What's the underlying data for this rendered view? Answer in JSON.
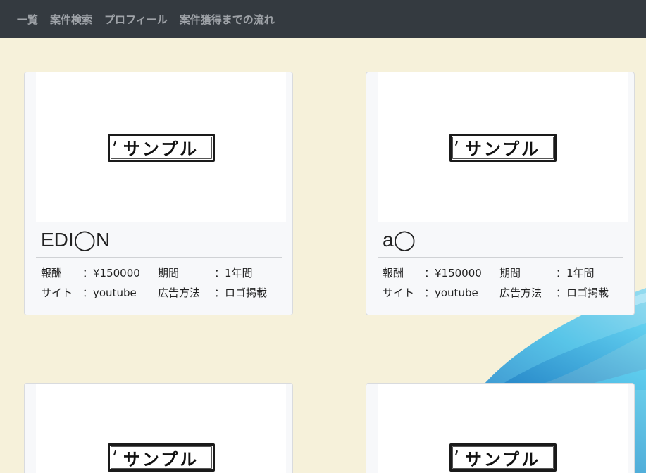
{
  "nav": {
    "items": [
      "一覧",
      "案件検索",
      "プロフィール",
      "案件獲得までの流れ"
    ]
  },
  "labels": {
    "reward": "報酬",
    "period": "期間",
    "site": "サイト",
    "method": "広告方法",
    "sample": "サンプル"
  },
  "cards": [
    {
      "title": "EDI◯N",
      "reward": "：¥150000",
      "period": "：1年間",
      "site": "：youtube",
      "method": "：ロゴ掲載"
    },
    {
      "title": "a◯",
      "reward": "：¥150000",
      "period": "：1年間",
      "site": "：youtube",
      "method": "：ロゴ掲載"
    },
    {
      "title": "",
      "reward": "",
      "period": "",
      "site": "",
      "method": ""
    },
    {
      "title": "",
      "reward": "",
      "period": "",
      "site": "",
      "method": ""
    }
  ],
  "colors": {
    "navbar": "#343a40",
    "nav_text": "#9fa3a8",
    "page_bg": "#f6f1da",
    "card_bg": "#f7f8fa",
    "swirl": "#3ab0e2"
  }
}
